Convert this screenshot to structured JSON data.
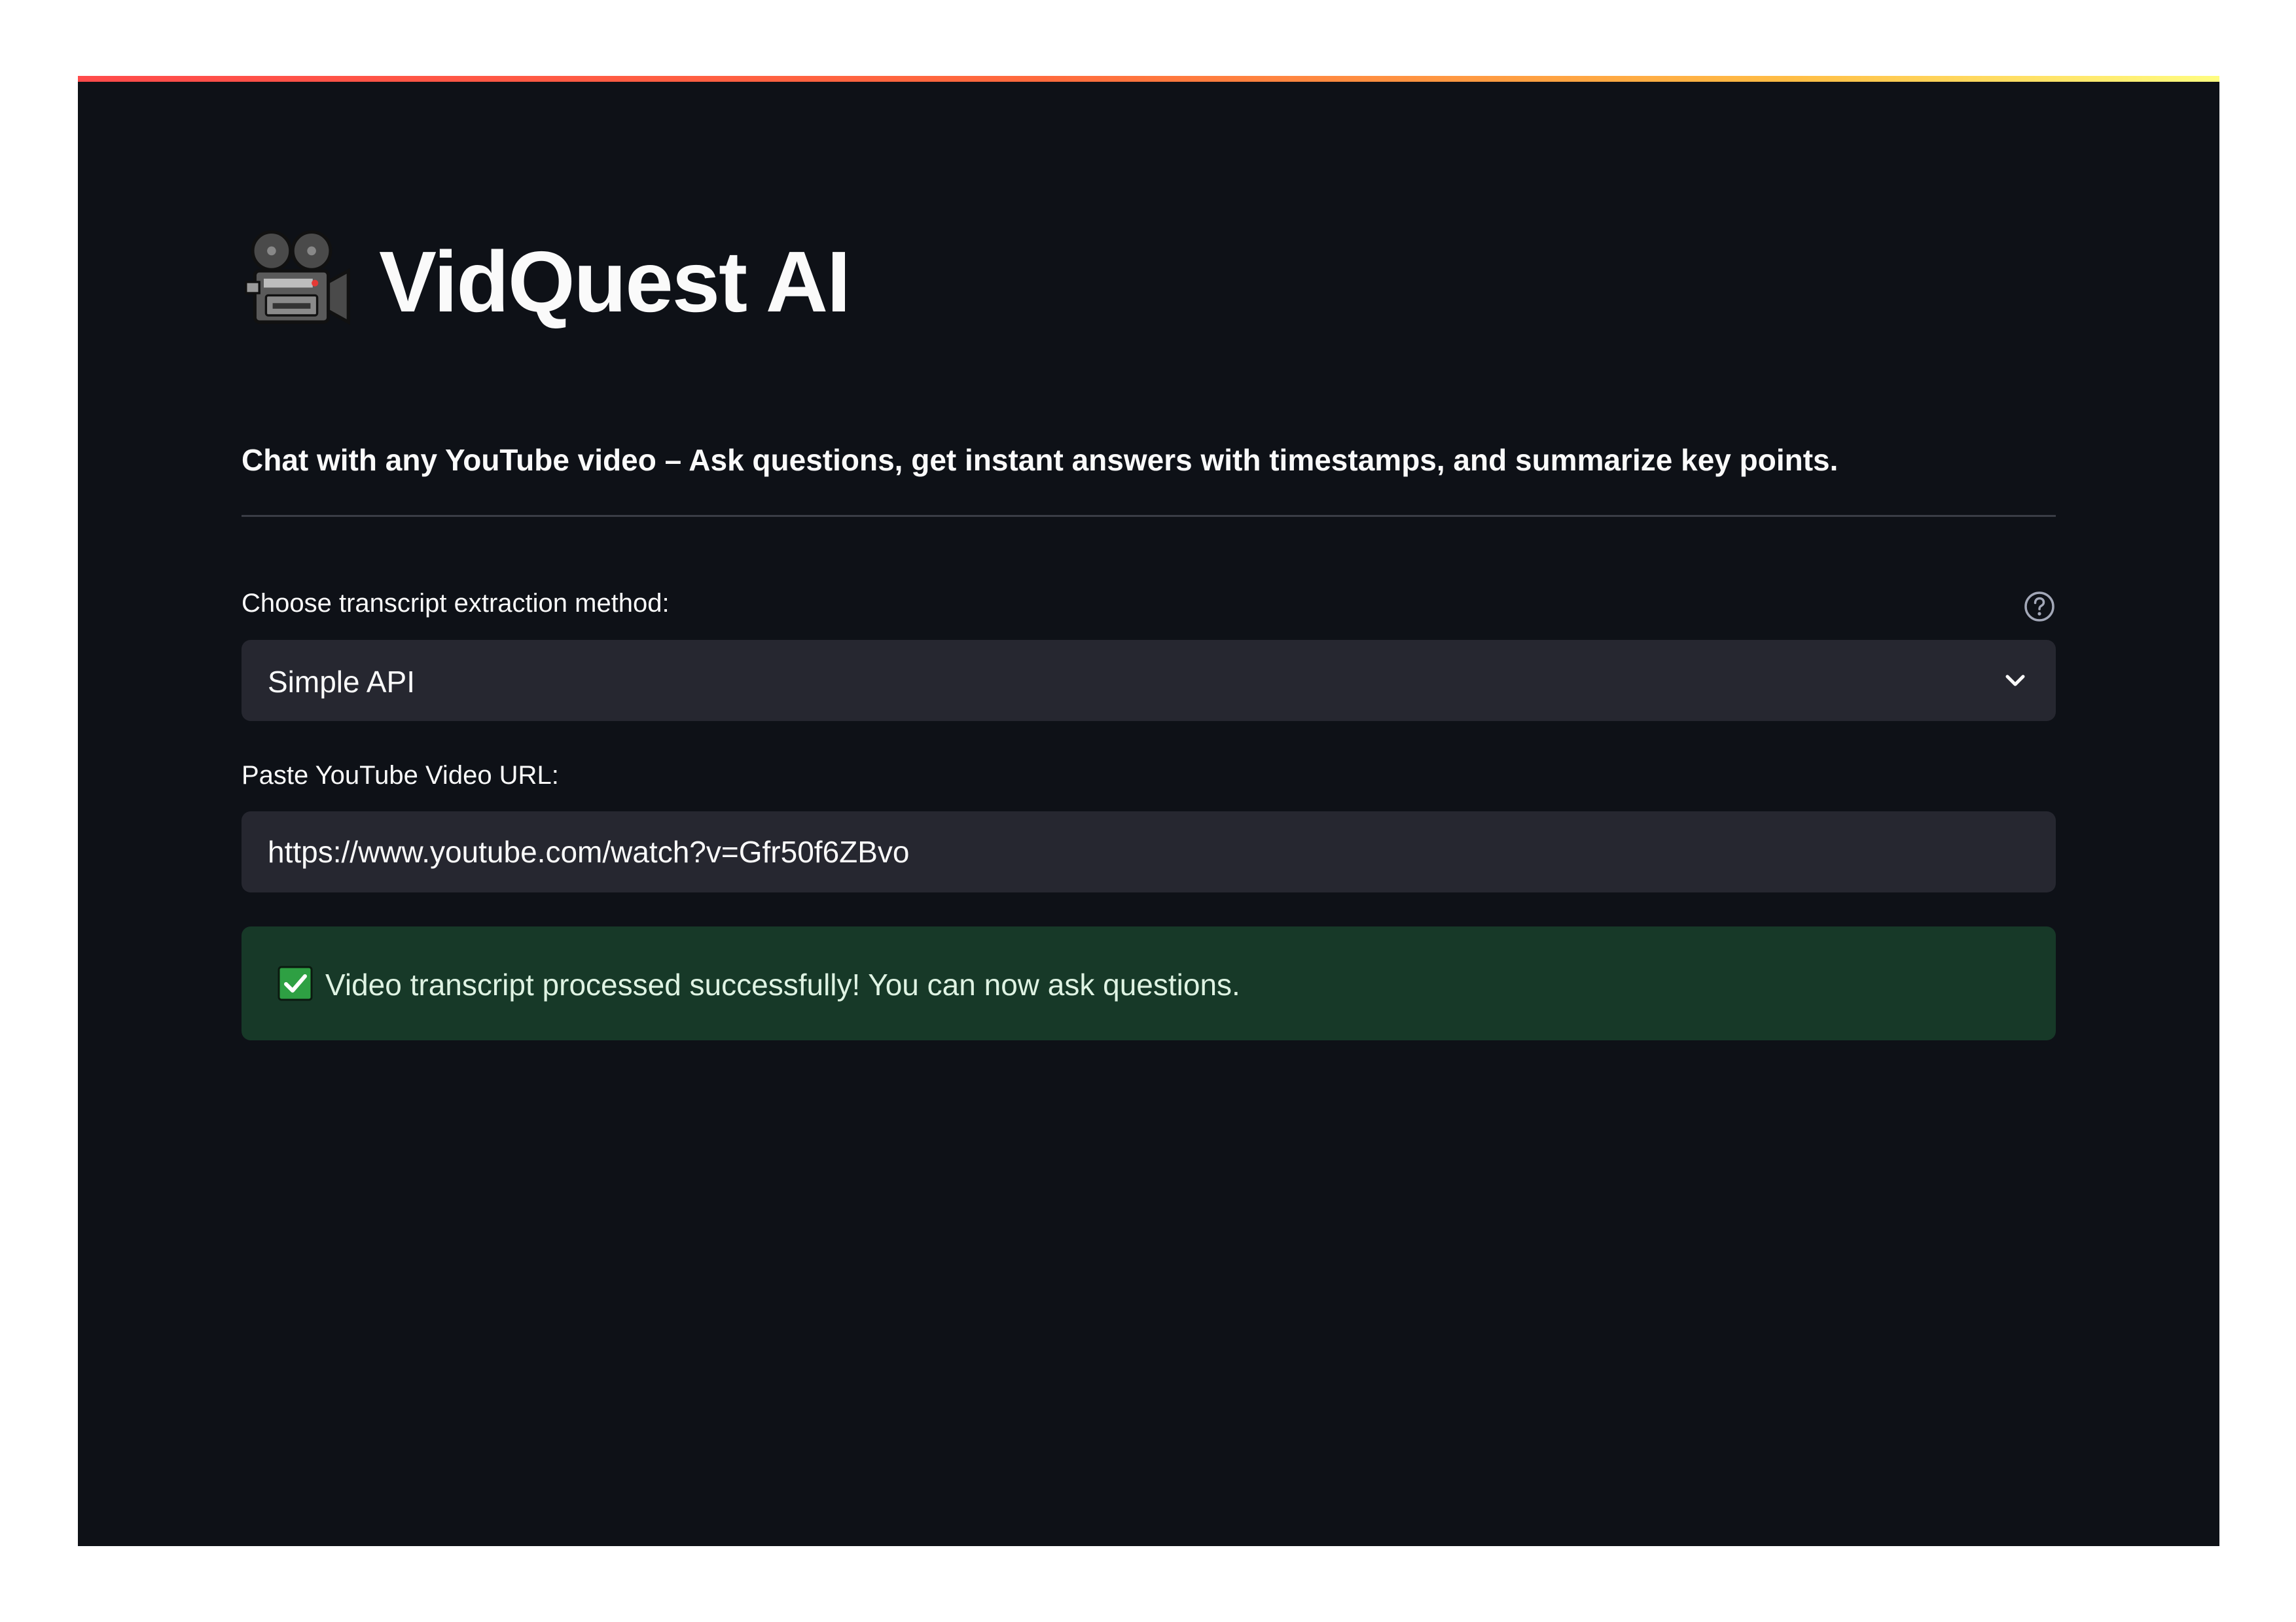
{
  "app": {
    "title": "VidQuest AI",
    "title_icon": "movie-camera-icon",
    "subtitle": "Chat with any YouTube video – Ask questions, get instant answers with timestamps, and summarize key points."
  },
  "method": {
    "label": "Choose transcript extraction method:",
    "help_icon": "help-circle-icon",
    "selected": "Simple API"
  },
  "url": {
    "label": "Paste YouTube Video URL:",
    "value": "https://www.youtube.com/watch?v=Gfr50f6ZBvo"
  },
  "status": {
    "icon": "check-mark-icon",
    "message": "Video transcript processed successfully! You can now ask questions."
  },
  "colors": {
    "background": "#0e1117",
    "input_background": "#262730",
    "success_background": "#173928",
    "success_check": "#2ea043",
    "text": "#fafafa"
  }
}
